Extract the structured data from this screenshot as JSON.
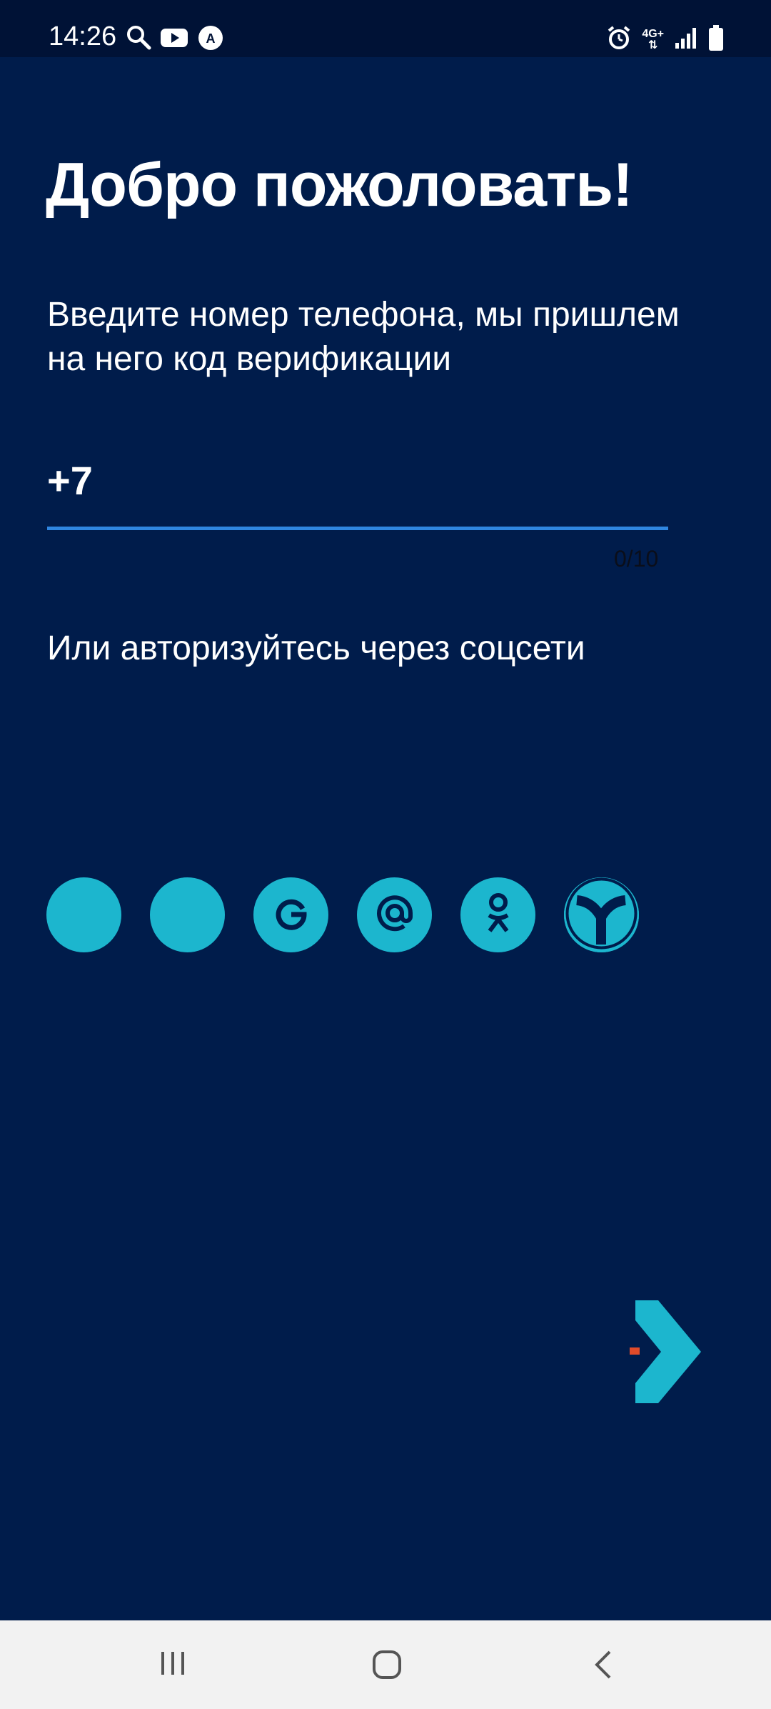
{
  "status_bar": {
    "time": "14:26",
    "left_icons": [
      "search-icon",
      "youtube-icon",
      "translate-icon"
    ],
    "right_icons": [
      "alarm-icon",
      "network-4g-icon",
      "signal-icon",
      "battery-icon"
    ],
    "network_label": "4G+"
  },
  "main": {
    "title": "Добро пожоловать!",
    "subtitle": "Введите номер телефона, мы пришлем на него код верификации",
    "phone": {
      "value": "+7",
      "counter": "0/10"
    },
    "social_title": "Или авторизуйтесь через соцсети",
    "social_buttons": [
      {
        "name": "social-blank-1",
        "icon": "blank-icon"
      },
      {
        "name": "social-blank-2",
        "icon": "blank-icon"
      },
      {
        "name": "social-google",
        "icon": "google-icon"
      },
      {
        "name": "social-mail",
        "icon": "at-icon"
      },
      {
        "name": "social-ok",
        "icon": "odnoklassniki-icon"
      },
      {
        "name": "social-yandex",
        "icon": "yandex-icon"
      }
    ]
  },
  "colors": {
    "background": "#001c4b",
    "accent": "#1cb6ce",
    "underline": "#2f86e0"
  },
  "nav_bar": {
    "icons": [
      "recent-apps-icon",
      "home-icon",
      "back-icon"
    ]
  }
}
